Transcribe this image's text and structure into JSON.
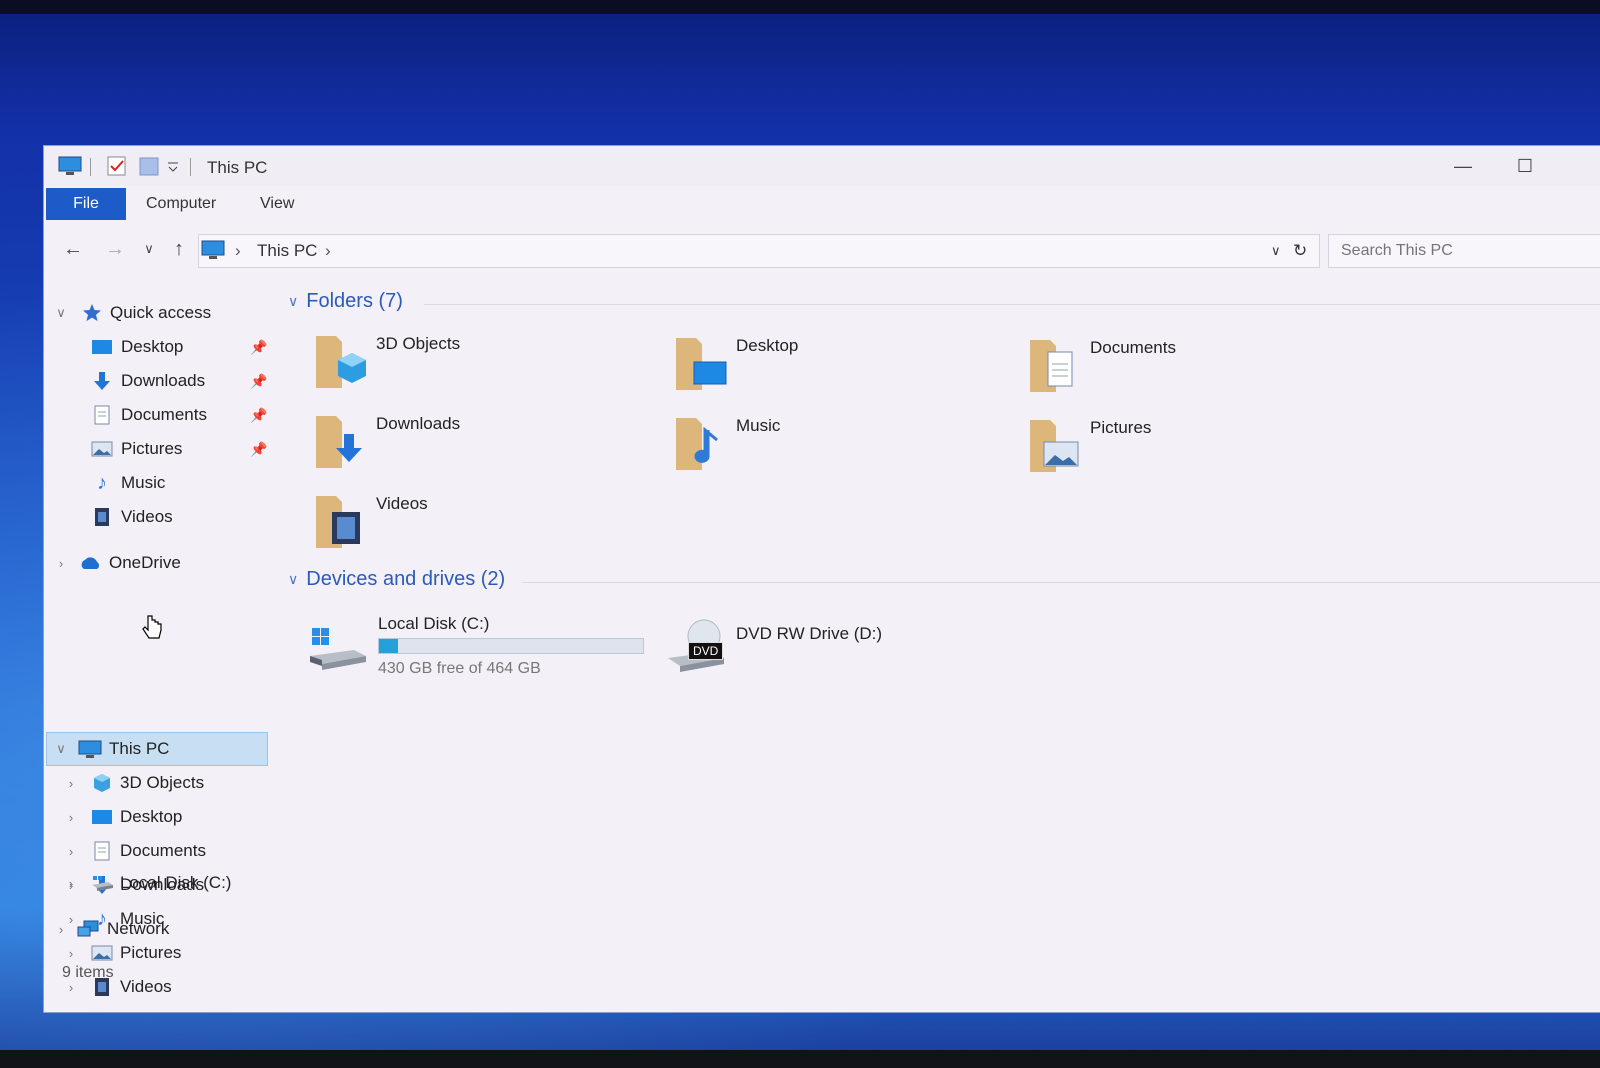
{
  "window": {
    "title": "This PC",
    "item_count": "9 items"
  },
  "ribbon": {
    "tabs": [
      "File",
      "Computer",
      "View"
    ]
  },
  "address": {
    "crumbs": [
      "This PC"
    ],
    "search_placeholder": "Search This PC"
  },
  "sidebar": {
    "quick_access": "Quick access",
    "pinned": [
      "Desktop",
      "Downloads",
      "Documents",
      "Pictures"
    ],
    "unpinned": [
      "Music",
      "Videos"
    ],
    "onedrive": "OneDrive",
    "this_pc": "This PC",
    "this_pc_children": [
      "3D Objects",
      "Desktop",
      "Documents",
      "Downloads",
      "Music",
      "Pictures",
      "Videos",
      "Local Disk (C:)"
    ],
    "network": "Network"
  },
  "content": {
    "folders_header": "Folders (7)",
    "folders": [
      "3D Objects",
      "Desktop",
      "Documents",
      "Downloads",
      "Music",
      "Pictures",
      "Videos"
    ],
    "devices_header": "Devices and drives (2)",
    "drives": [
      {
        "name": "Local Disk (C:)",
        "free_text": "430 GB free of 464 GB",
        "used_fraction": 0.073
      },
      {
        "name": "DVD RW Drive (D:)",
        "badge": "DVD"
      }
    ]
  },
  "colors": {
    "accent": "#1c5bc8",
    "header_blue": "#2a5bb8",
    "selection": "#c7def3",
    "folder": "#dcb67a"
  }
}
